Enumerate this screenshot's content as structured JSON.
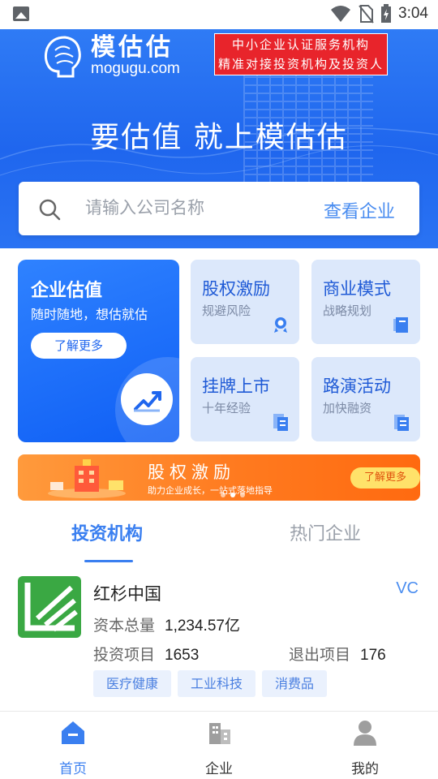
{
  "status_bar": {
    "time": "3:04"
  },
  "banner": {
    "brand_name": "模估估",
    "brand_domain": "mogugu.com",
    "tagline_line1": "中小企业认证服务机构",
    "tagline_line2": "精准对接投资机构及投资人",
    "slogan": "要估值 就上模估估",
    "search_placeholder": "请输入公司名称",
    "search_action": "查看企业"
  },
  "services": {
    "main": {
      "title": "企业估值",
      "subtitle": "随时随地，想估就估",
      "button": "了解更多"
    },
    "items": [
      {
        "title": "股权激励",
        "subtitle": "规避风险",
        "icon": "equity-icon"
      },
      {
        "title": "商业模式",
        "subtitle": "战略规划",
        "icon": "book-icon"
      },
      {
        "title": "挂牌上市",
        "subtitle": "十年经验",
        "icon": "listing-icon"
      },
      {
        "title": "路演活动",
        "subtitle": "加快融资",
        "icon": "roadshow-icon"
      }
    ]
  },
  "promo": {
    "title": "股权激励",
    "subtitle": "助力企业成长，一站式落地指导",
    "button": "了解更多"
  },
  "tabs": {
    "active": "投资机构",
    "inactive": "热门企业"
  },
  "org": {
    "name": "红杉中国",
    "type": "VC",
    "capital_label": "资本总量",
    "capital_value": "1,234.57亿",
    "invest_label": "投资项目",
    "invest_value": "1653",
    "exit_label": "退出项目",
    "exit_value": "176",
    "tags": [
      "医疗健康",
      "工业科技",
      "消费品"
    ],
    "logo_color": "#3aa843"
  },
  "nav": {
    "home": "首页",
    "enterprise": "企业",
    "me": "我的",
    "active_color": "#3a7ff0"
  }
}
